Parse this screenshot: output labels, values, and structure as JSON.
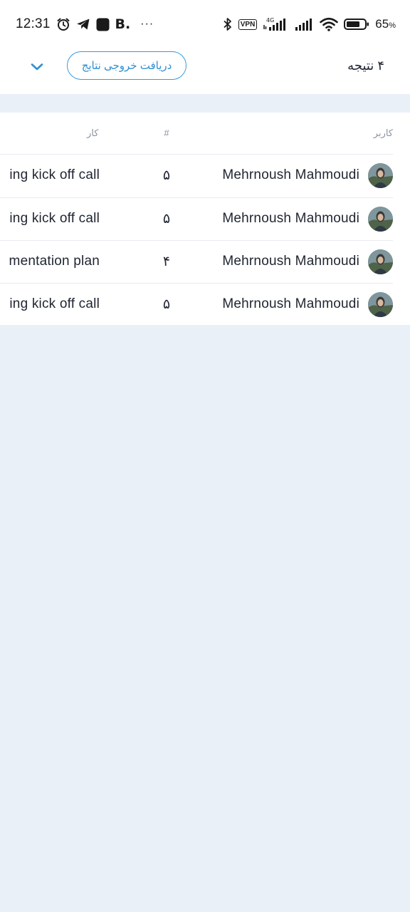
{
  "status_bar": {
    "time": "12:31",
    "left_icons": [
      "alarm-icon",
      "telegram-icon",
      "app-icon",
      "b-icon",
      "more-icon"
    ],
    "b_label": "B.",
    "more_label": "···",
    "vpn_label": "VPN",
    "network_label": "4G",
    "battery_percent": "65",
    "battery_unit": "%"
  },
  "top_bar": {
    "results_count": "۴ نتیجه",
    "export_label": "دریافت خروجی نتایج",
    "accent_color": "#3a9ad9"
  },
  "table": {
    "headers": {
      "user": "کاربر",
      "number": "#",
      "task": "کار"
    },
    "rows": [
      {
        "user": "Mehrnoush Mahmoudi",
        "number": "۵",
        "task": "ing kick off call"
      },
      {
        "user": "Mehrnoush Mahmoudi",
        "number": "۵",
        "task": "ing kick off call"
      },
      {
        "user": "Mehrnoush Mahmoudi",
        "number": "۴",
        "task": "mentation plan"
      },
      {
        "user": "Mehrnoush Mahmoudi",
        "number": "۵",
        "task": "ing kick off call"
      }
    ]
  }
}
